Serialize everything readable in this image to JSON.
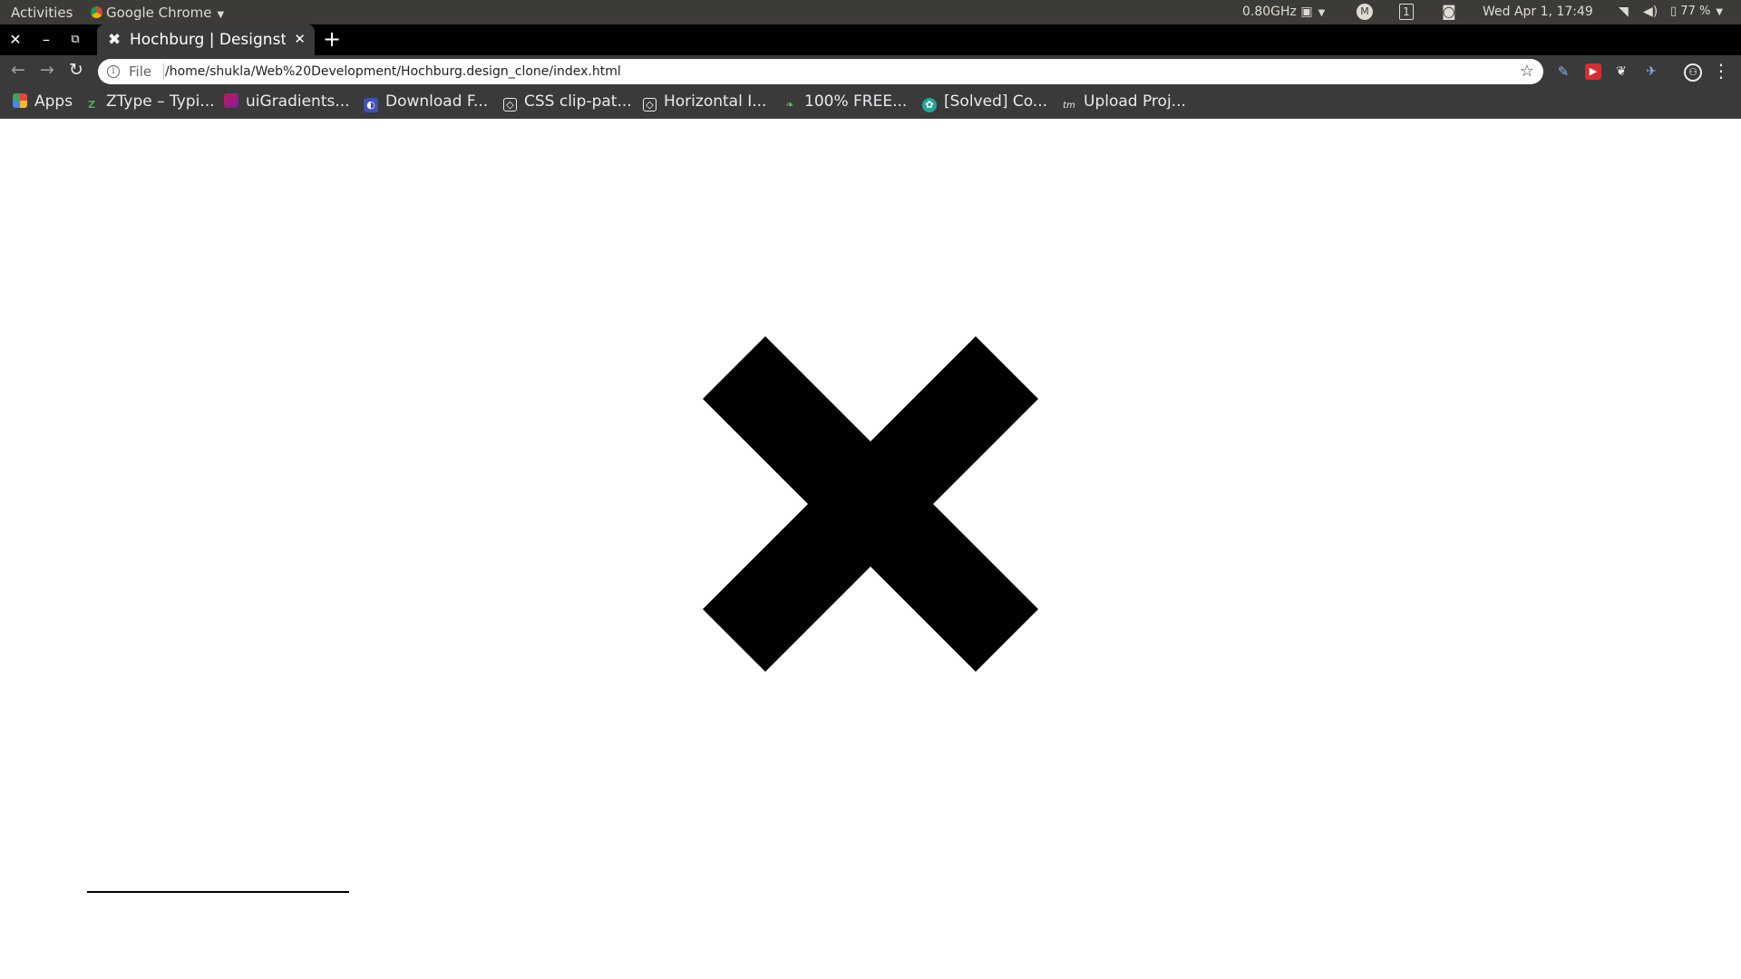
{
  "system_bar": {
    "activities": "Activities",
    "app_name": "Google Chrome",
    "cpu_freq": "0.80GHz",
    "workspace": "1",
    "datetime": "Wed Apr  1, 17:49",
    "battery": "77 %"
  },
  "tab": {
    "title": "Hochburg | Designstudio"
  },
  "omnibox": {
    "scheme": "File",
    "url": "/home/shukla/Web%20Development/Hochburg.design_clone/index.html"
  },
  "bookmarks": [
    {
      "label": "Apps",
      "icon": "apps-grid-icon",
      "color": "#e8453c"
    },
    {
      "label": "ZType – Typi...",
      "icon": "ztype-icon",
      "color": "#4caf50"
    },
    {
      "label": "uiGradients...",
      "icon": "uigradients-icon",
      "color": "#c2185b"
    },
    {
      "label": "Download F...",
      "icon": "download-icon",
      "color": "#3f51b5"
    },
    {
      "label": "CSS clip-pat...",
      "icon": "codepen-icon",
      "color": "#444444"
    },
    {
      "label": "Horizontal I...",
      "icon": "codepen-icon",
      "color": "#444444"
    },
    {
      "label": "100% FREE...",
      "icon": "free-icon",
      "color": "#66bb6a"
    },
    {
      "label": "[Solved] Co...",
      "icon": "solved-icon",
      "color": "#26a69a"
    },
    {
      "label": "Upload Proj...",
      "icon": "upload-icon",
      "color": "#555555"
    }
  ],
  "colors": {
    "topbar": "#3c3b37",
    "tabstrip": "#000000",
    "toolbar": "#3a3a3a",
    "page_bg": "#ffffff",
    "glyph": "#000000"
  }
}
